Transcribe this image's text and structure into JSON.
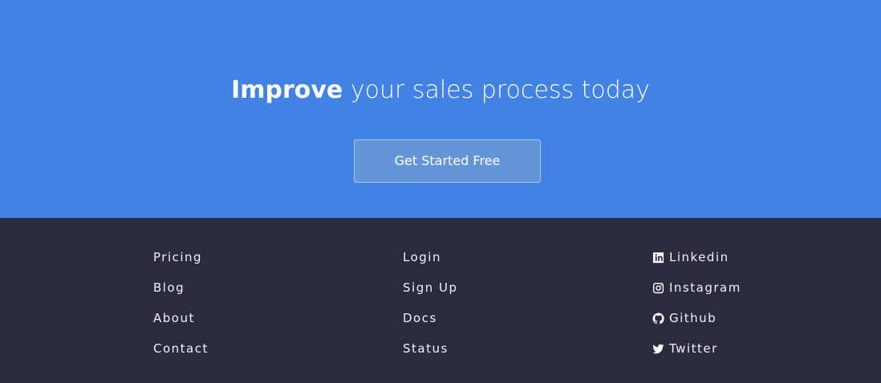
{
  "cta": {
    "headline_bold": "Improve",
    "headline_rest": " your sales process today",
    "button_label": "Get Started Free",
    "background": "#4282e4"
  },
  "footer": {
    "background": "#2b2b40",
    "column1": [
      {
        "label": "Pricing"
      },
      {
        "label": "Blog"
      },
      {
        "label": "About"
      },
      {
        "label": "Contact"
      }
    ],
    "column2": [
      {
        "label": "Login"
      },
      {
        "label": "Sign Up"
      },
      {
        "label": "Docs"
      },
      {
        "label": "Status"
      }
    ],
    "social": [
      {
        "label": "Linkedin",
        "icon": "linkedin-icon"
      },
      {
        "label": "Instagram",
        "icon": "instagram-icon"
      },
      {
        "label": "Github",
        "icon": "github-icon"
      },
      {
        "label": "Twitter",
        "icon": "twitter-icon"
      }
    ]
  }
}
